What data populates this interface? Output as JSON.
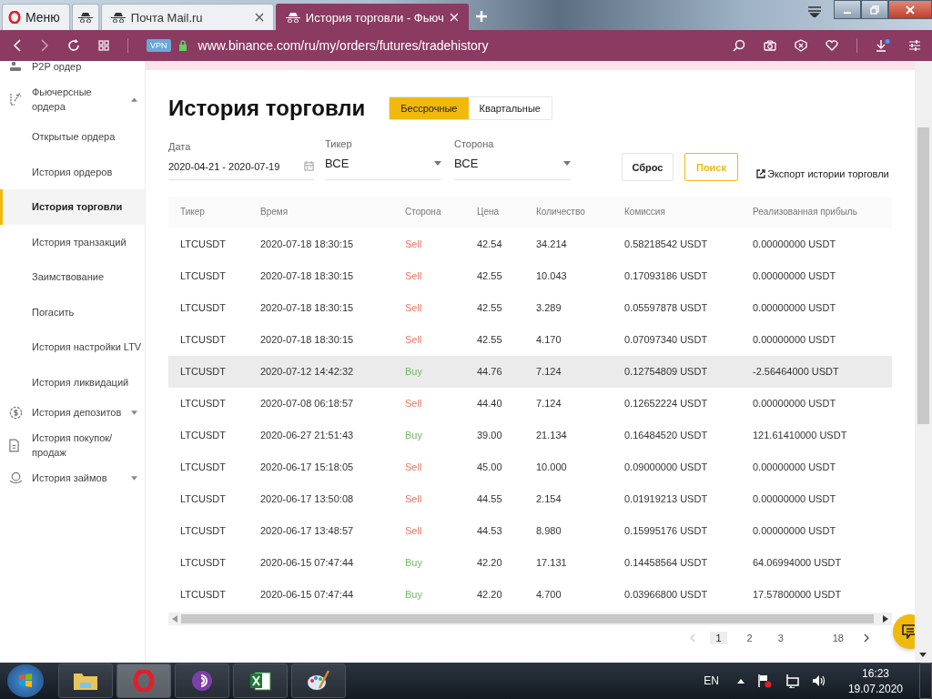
{
  "browser": {
    "menu_label": "Меню",
    "tabs": [
      {
        "selected": false
      },
      {
        "title": "Почта Mail.ru",
        "selected": false
      },
      {
        "title": "История торговли - Фьюч",
        "selected": true
      }
    ],
    "vpn_badge": "VPN",
    "url": "www.binance.com/ru/my/orders/futures/tradehistory"
  },
  "sidebar": {
    "items": [
      {
        "label": "P2P ордер"
      },
      {
        "label": "Фьючерсные ордера",
        "expanded": true,
        "children": [
          {
            "label": "Открытые ордера",
            "selected": false
          },
          {
            "label": "История ордеров",
            "selected": false
          },
          {
            "label": "История торговли",
            "selected": true
          },
          {
            "label": "История транзакций",
            "selected": false
          },
          {
            "label": "Заимствование",
            "selected": false
          },
          {
            "label": "Погасить",
            "selected": false
          },
          {
            "label": "История настройки LTV",
            "selected": false
          },
          {
            "label": "История ликвидаций",
            "selected": false
          }
        ]
      },
      {
        "label": "История депозитов",
        "expanded": false
      },
      {
        "label": "История покупок/ продаж"
      },
      {
        "label": "История займов",
        "expanded": false
      }
    ]
  },
  "page": {
    "title": "История торговли",
    "segments": [
      {
        "label": "Бессрочные",
        "selected": true
      },
      {
        "label": "Квартальные",
        "selected": false
      }
    ],
    "filters": {
      "date": {
        "label": "Дата",
        "value": "2020-04-21 - 2020-07-19"
      },
      "ticker": {
        "label": "Тикер",
        "value": "ВСЕ"
      },
      "side": {
        "label": "Сторона",
        "value": "ВСЕ"
      }
    },
    "reset_button": "Сброс",
    "search_button": "Поиск",
    "export_link": "Экспорт истории торговли",
    "table": {
      "columns": [
        "Тикер",
        "Время",
        "Сторона",
        "Цена",
        "Количество",
        "Комиссия",
        "Реализованная прибыль"
      ],
      "rows": [
        {
          "cells": [
            "LTCUSDT",
            "2020-07-18 18:30:15",
            "Sell",
            "42.54",
            "34.214",
            "0.58218542 USDT",
            "0.00000000 USDT"
          ],
          "color": "#e9735f",
          "hovered": false
        },
        {
          "cells": [
            "LTCUSDT",
            "2020-07-18 18:30:15",
            "Sell",
            "42.55",
            "10.043",
            "0.17093186 USDT",
            "0.00000000 USDT"
          ],
          "color": "#e9735f",
          "hovered": false
        },
        {
          "cells": [
            "LTCUSDT",
            "2020-07-18 18:30:15",
            "Sell",
            "42.55",
            "3.289",
            "0.05597878 USDT",
            "0.00000000 USDT"
          ],
          "color": "#e9735f",
          "hovered": false
        },
        {
          "cells": [
            "LTCUSDT",
            "2020-07-18 18:30:15",
            "Sell",
            "42.55",
            "4.170",
            "0.07097340 USDT",
            "0.00000000 USDT"
          ],
          "color": "#e9735f",
          "hovered": false
        },
        {
          "cells": [
            "LTCUSDT",
            "2020-07-12 14:42:32",
            "Buy",
            "44.76",
            "7.124",
            "0.12754809 USDT",
            "-2.56464000 USDT"
          ],
          "color": "#70b865",
          "hovered": true
        },
        {
          "cells": [
            "LTCUSDT",
            "2020-07-08 06:18:57",
            "Sell",
            "44.40",
            "7.124",
            "0.12652224 USDT",
            "0.00000000 USDT"
          ],
          "color": "#e9735f",
          "hovered": false
        },
        {
          "cells": [
            "LTCUSDT",
            "2020-06-27 21:51:43",
            "Buy",
            "39.00",
            "21.134",
            "0.16484520 USDT",
            "121.61410000 USDT"
          ],
          "color": "#70b865",
          "hovered": false
        },
        {
          "cells": [
            "LTCUSDT",
            "2020-06-17 15:18:05",
            "Sell",
            "45.00",
            "10.000",
            "0.09000000 USDT",
            "0.00000000 USDT"
          ],
          "color": "#e9735f",
          "hovered": false
        },
        {
          "cells": [
            "LTCUSDT",
            "2020-06-17 13:50:08",
            "Sell",
            "44.55",
            "2.154",
            "0.01919213 USDT",
            "0.00000000 USDT"
          ],
          "color": "#e9735f",
          "hovered": false
        },
        {
          "cells": [
            "LTCUSDT",
            "2020-06-17 13:48:57",
            "Sell",
            "44.53",
            "8.980",
            "0.15995176 USDT",
            "0.00000000 USDT"
          ],
          "color": "#e9735f",
          "hovered": false
        },
        {
          "cells": [
            "LTCUSDT",
            "2020-06-15 07:47:44",
            "Buy",
            "42.20",
            "17.131",
            "0.14458564 USDT",
            "64.06994000 USDT"
          ],
          "color": "#70b865",
          "hovered": false
        },
        {
          "cells": [
            "LTCUSDT",
            "2020-06-15 07:47:44",
            "Buy",
            "42.20",
            "4.700",
            "0.03966800 USDT",
            "17.57800000 USDT"
          ],
          "color": "#70b865",
          "hovered": false
        }
      ]
    },
    "pagination": [
      {
        "label": "1",
        "selected": true
      },
      {
        "label": "2",
        "selected": false
      },
      {
        "label": "3",
        "selected": false
      },
      {
        "label": "18",
        "selected": false
      }
    ]
  },
  "taskbar": {
    "apps": [
      {
        "kind": "explorer",
        "selected": false
      },
      {
        "kind": "opera",
        "selected": true
      },
      {
        "kind": "tor",
        "selected": false
      },
      {
        "kind": "excel",
        "selected": false
      },
      {
        "kind": "paint",
        "selected": false
      }
    ],
    "language": "EN",
    "time": "16:23",
    "date": "19.07.2020"
  }
}
